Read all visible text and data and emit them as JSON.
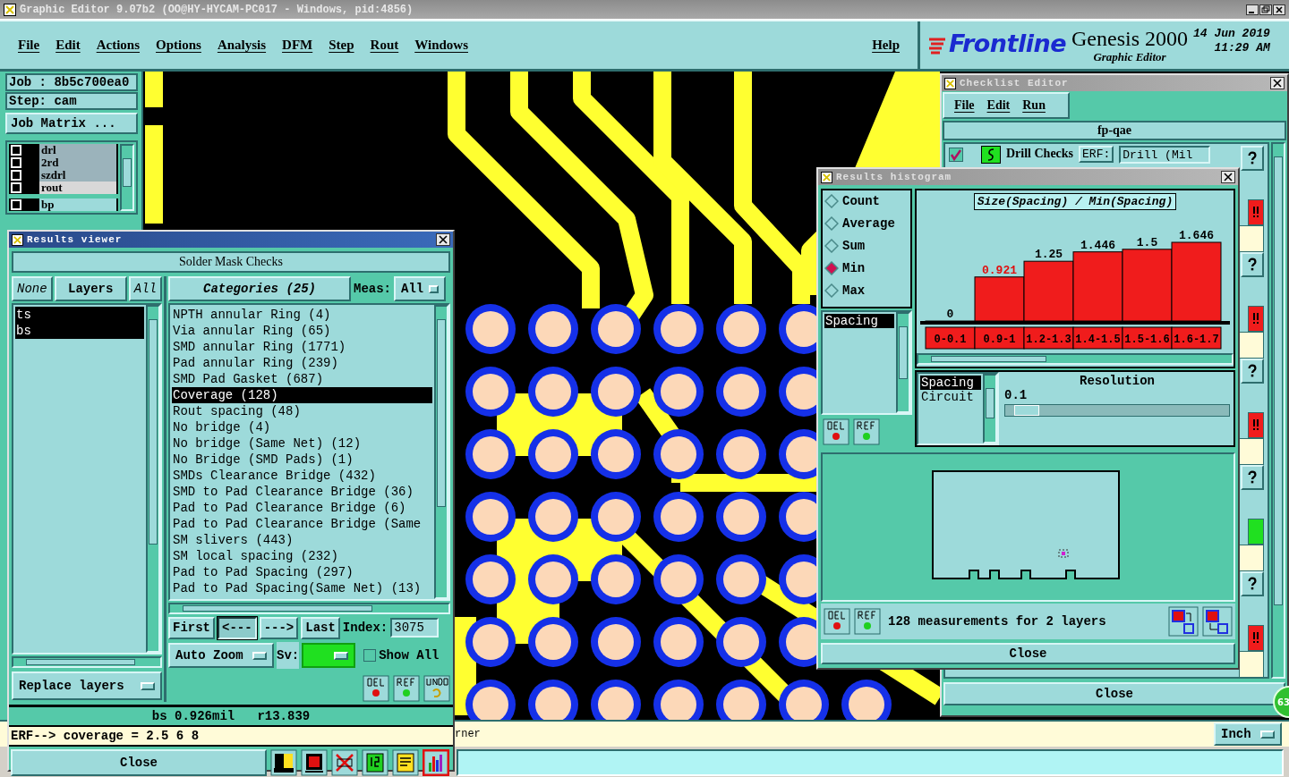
{
  "window": {
    "title": "Graphic Editor 9.07b2 (OO@HY-HYCAM-PC017 - Windows, pid:4856)"
  },
  "menu": [
    "File",
    "Edit",
    "Actions",
    "Options",
    "Analysis",
    "DFM",
    "Step",
    "Rout",
    "Windows"
  ],
  "help": "Help",
  "brand": {
    "logo": "Frontline",
    "product": "Genesis 2000",
    "subtitle": "Graphic Editor",
    "date": "14 Jun 2019",
    "time": "11:29 AM"
  },
  "job_panel": {
    "job": "Job : 8b5c700ea0",
    "step": "Step: cam",
    "matrix_button": "Job Matrix ...",
    "layers": [
      {
        "name": "drl",
        "checked": false,
        "color": "#9bb3bb"
      },
      {
        "name": "2rd",
        "checked": false,
        "color": "#9bb3bb"
      },
      {
        "name": "szdrl",
        "checked": false,
        "color": "#9bb3bb"
      },
      {
        "name": "rout",
        "checked": false,
        "color": "#d8d8d8"
      },
      {
        "name": "bp",
        "checked": false,
        "color": "#9ddada"
      }
    ]
  },
  "status_line": {
    "message": "rner",
    "units": "Inch"
  },
  "results_viewer": {
    "title": "Results viewer",
    "heading": "Solder Mask Checks",
    "layer_buttons": [
      "None",
      "Layers",
      "All"
    ],
    "layers": [
      {
        "name": "ts",
        "selected": true
      },
      {
        "name": "bs",
        "selected": true
      }
    ],
    "categories_button": "Categories (25)",
    "meas_label": "Meas:",
    "meas_value": "All",
    "categories": [
      {
        "name": "NPTH annular Ring (4)",
        "selected": false
      },
      {
        "name": "Via annular Ring (65)",
        "selected": false
      },
      {
        "name": "SMD annular Ring (1771)",
        "selected": false
      },
      {
        "name": "Pad annular Ring (239)",
        "selected": false
      },
      {
        "name": "SMD Pad Gasket (687)",
        "selected": false
      },
      {
        "name": "Coverage (128)",
        "selected": true
      },
      {
        "name": "Rout spacing (48)",
        "selected": false
      },
      {
        "name": "No bridge (4)",
        "selected": false
      },
      {
        "name": "No bridge (Same Net) (12)",
        "selected": false
      },
      {
        "name": "No Bridge (SMD Pads) (1)",
        "selected": false
      },
      {
        "name": "SMDs Clearance Bridge (432)",
        "selected": false
      },
      {
        "name": "SMD to Pad Clearance Bridge (36)",
        "selected": false
      },
      {
        "name": "Pad to Pad Clearance Bridge (6)",
        "selected": false
      },
      {
        "name": "Pad to Pad Clearance Bridge (Same",
        "selected": false
      },
      {
        "name": "SM slivers (443)",
        "selected": false
      },
      {
        "name": "SM local spacing (232)",
        "selected": false
      },
      {
        "name": "Pad to Pad Spacing (297)",
        "selected": false
      },
      {
        "name": "Pad to Pad Spacing(Same Net) (13)",
        "selected": false
      }
    ],
    "nav": [
      {
        "label": "First",
        "selected": false
      },
      {
        "label": "<---",
        "selected": true
      },
      {
        "label": "--->",
        "selected": false
      },
      {
        "label": "Last",
        "selected": false
      }
    ],
    "index_label": "Index:",
    "index_value": "3075",
    "zoom_mode": "Auto Zoom",
    "sv_label": "Sv:",
    "show_all": {
      "label": "Show All",
      "checked": false
    },
    "replace_mode": "Replace layers",
    "measurement": "bs 0.926mil   r13.839",
    "erf_line": "ERF--> coverage = 2.5 6 8",
    "close": "Close",
    "tools": [
      {
        "kind": "highlight",
        "selected": false
      },
      {
        "kind": "measure",
        "selected": false
      },
      {
        "kind": "erf",
        "selected": false
      },
      {
        "kind": "numbering",
        "selected": false
      },
      {
        "kind": "report",
        "selected": false
      },
      {
        "kind": "histogram",
        "selected": true
      }
    ]
  },
  "checklist_editor": {
    "title": "Checklist Editor",
    "menu": [
      "File",
      "Edit",
      "Run"
    ],
    "checklist": "fp-qae",
    "rows": [
      {
        "name": "Drill Checks",
        "checked": true,
        "erf_label": "ERF:",
        "erf_value": "Drill (Mil",
        "passed": false
      },
      {
        "passed": false
      },
      {
        "passed": false
      },
      {
        "passed": true
      },
      {
        "passed": false
      }
    ],
    "close": "Close"
  },
  "histogram": {
    "title": "Results histogram",
    "functions": [
      {
        "label": "Count",
        "selected": false
      },
      {
        "label": "Average",
        "selected": false
      },
      {
        "label": "Sum",
        "selected": false
      },
      {
        "label": "Min",
        "selected": true
      },
      {
        "label": "Max",
        "selected": false
      }
    ],
    "attributes": [
      {
        "name": "Spacing",
        "selected": true
      }
    ],
    "chart_data": {
      "type": "bar",
      "title": "Size(Spacing) / Min(Spacing)",
      "categories": [
        "0-0.1",
        "0.9-1",
        "1.2-1.3",
        "1.4-1.5",
        "1.5-1.6",
        "1.6-1.7"
      ],
      "values": [
        0,
        0.921,
        1.25,
        1.446,
        1.5,
        1.646
      ],
      "data_labels": true
    },
    "group_by": [
      {
        "name": "Spacing",
        "selected": true
      },
      {
        "name": "Circuit",
        "selected": false
      }
    ],
    "resolution_label": "Resolution",
    "resolution_value": "0.1",
    "resolution": {
      "level": 0.04
    },
    "summary": "128 measurements for 2 layers",
    "close": "Close"
  },
  "badge": "63"
}
